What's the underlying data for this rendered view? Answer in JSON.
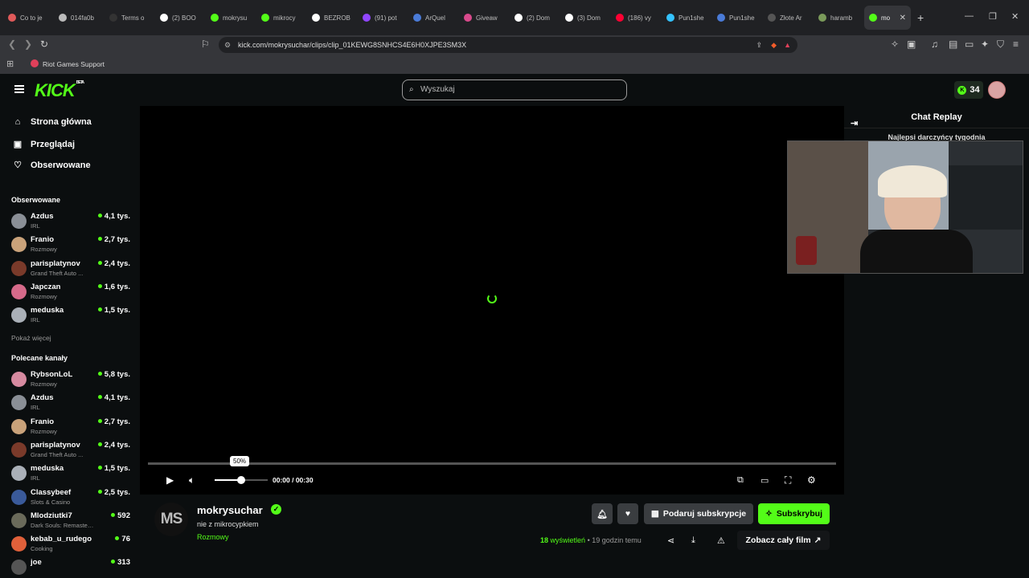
{
  "browser": {
    "tabs": [
      {
        "title": "Co to je",
        "color": "#e05a5a"
      },
      {
        "title": "014fa0b",
        "color": "#bbbbbb"
      },
      {
        "title": "Terms o",
        "color": "#333333"
      },
      {
        "title": "(2) BOO",
        "color": "#ffffff"
      },
      {
        "title": "mokrysu",
        "color": "#53fc18"
      },
      {
        "title": "mikrocy",
        "color": "#53fc18"
      },
      {
        "title": "BEZROB",
        "color": "#ffffff"
      },
      {
        "title": "(91) pot",
        "color": "#9146ff"
      },
      {
        "title": "ArQuel",
        "color": "#4a7bd8"
      },
      {
        "title": "Giveaw",
        "color": "#d94a8c"
      },
      {
        "title": "(2) Dom",
        "color": "#ffffff"
      },
      {
        "title": "(3) Dom",
        "color": "#ffffff"
      },
      {
        "title": "(186) vy",
        "color": "#ff0033"
      },
      {
        "title": "Pun1she",
        "color": "#34c3ff"
      },
      {
        "title": "Pun1she",
        "color": "#4a7bd8"
      },
      {
        "title": "Złote Ar",
        "color": "#555555"
      },
      {
        "title": "haramb",
        "color": "#7a9a5a"
      },
      {
        "title": "mo",
        "color": "#53fc18"
      }
    ],
    "url": "kick.com/mokrysuchar/clips/clip_01KEWG8SNHCS4E6H0XJPE3SM3X",
    "bookmark": "Riot Games Support"
  },
  "header": {
    "logo": "KICK",
    "logo_badge": "BETA",
    "search_placeholder": "Wyszukaj",
    "points": "34"
  },
  "sidebar": {
    "nav": [
      "Strona główna",
      "Przeglądaj",
      "Obserwowane"
    ],
    "followed_title": "Obserwowane",
    "followed": [
      {
        "name": "Azdus",
        "category": "IRL",
        "viewers": "4,1 tys.",
        "color": "#8a8f96"
      },
      {
        "name": "Franio",
        "category": "Rozmowy",
        "viewers": "2,7 tys.",
        "color": "#c9a27a"
      },
      {
        "name": "parisplatynov",
        "category": "Grand Theft Auto ...",
        "viewers": "2,4 tys.",
        "color": "#7a3a2a"
      },
      {
        "name": "Japczan",
        "category": "Rozmowy",
        "viewers": "1,6 tys.",
        "color": "#d66a8a"
      },
      {
        "name": "meduska",
        "category": "IRL",
        "viewers": "1,5 tys.",
        "color": "#aab0b8"
      }
    ],
    "show_more": "Pokaż więcej",
    "recommended_title": "Polecane kanały",
    "recommended": [
      {
        "name": "RybsonLoL",
        "category": "Rozmowy",
        "viewers": "5,8 tys.",
        "color": "#d68aa0"
      },
      {
        "name": "Azdus",
        "category": "IRL",
        "viewers": "4,1 tys.",
        "color": "#8a8f96"
      },
      {
        "name": "Franio",
        "category": "Rozmowy",
        "viewers": "2,7 tys.",
        "color": "#c9a27a"
      },
      {
        "name": "parisplatynov",
        "category": "Grand Theft Auto ...",
        "viewers": "2,4 tys.",
        "color": "#7a3a2a"
      },
      {
        "name": "meduska",
        "category": "IRL",
        "viewers": "1,5 tys.",
        "color": "#aab0b8"
      },
      {
        "name": "Classybeef",
        "category": "Slots & Casino",
        "viewers": "2,5 tys.",
        "color": "#3a5a9a"
      },
      {
        "name": "Mlodziutki7",
        "category": "Dark Souls: Remastered",
        "viewers": "592",
        "color": "#6a6a5a"
      },
      {
        "name": "kebab_u_rudego",
        "category": "Cooking",
        "viewers": "76",
        "color": "#e0603a"
      },
      {
        "name": "joe",
        "category": "",
        "viewers": "313",
        "color": "#555555"
      }
    ]
  },
  "player": {
    "volume_tooltip": "50%",
    "volume_level": 0.5,
    "time": "00:00 / 00:30",
    "progress": 0
  },
  "clip": {
    "avatar_text": "MS",
    "channel": "mokrysuchar",
    "title": "nie z mikrocypkiem",
    "category": "Rozmowy",
    "gift_subs": "Podaruj subskrypcje",
    "subscribe": "Subskrybuj",
    "views_count": "18",
    "views_label": "wyświetleń",
    "age": "• 19 godzin temu",
    "full_video": "Zobacz cały film"
  },
  "chat": {
    "title": "Chat Replay",
    "top_donors": "Najlepsi darczyńcy tygodnia"
  },
  "colors": {
    "accent": "#53fc18",
    "bg": "#0b0e0f"
  }
}
